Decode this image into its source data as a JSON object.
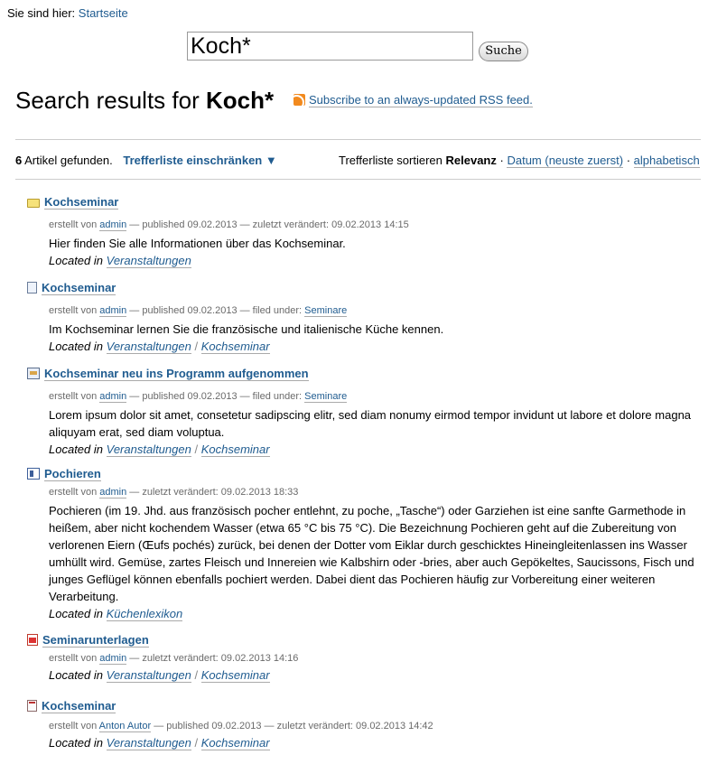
{
  "breadcrumb": {
    "prefix": "Sie sind hier:",
    "home": "Startseite"
  },
  "search": {
    "value": "Koch*",
    "button": "Suche"
  },
  "heading": {
    "prefix": "Search results for",
    "term": "Koch*"
  },
  "rss": {
    "label": "Subscribe to an always-updated RSS feed."
  },
  "bar": {
    "count": "6",
    "count_suffix": "Artikel gefunden.",
    "filter": "Trefferliste einschränken ▼",
    "sort_prefix": "Trefferliste sortieren",
    "sort_active": "Relevanz",
    "sort_date": "Datum (neuste zuerst)",
    "sort_alpha": "alphabetisch",
    "dot": "·"
  },
  "results": [
    {
      "icon": "folder-icon",
      "title": "Kochseminar",
      "by": "erstellt von",
      "author": "admin",
      "meta": "— published 09.02.2013 — zuletzt verändert: 09.02.2013 14:15",
      "desc": "Hier finden Sie alle Informationen über das Kochseminar.",
      "located": "Located in",
      "path": [
        "Veranstaltungen"
      ]
    },
    {
      "icon": "page-icon",
      "title": "Kochseminar",
      "by": "erstellt von",
      "author": "admin",
      "meta": "— published 09.02.2013 — filed under:",
      "tag": "Seminare",
      "desc": "Im Kochseminar lernen Sie die französische und italienische Küche kennen.",
      "located": "Located in",
      "path": [
        "Veranstaltungen",
        "Kochseminar"
      ]
    },
    {
      "icon": "news-icon",
      "title": "Kochseminar neu ins Programm aufgenommen",
      "by": "erstellt von",
      "author": "admin",
      "meta": "— published 09.02.2013 — filed under:",
      "tag": "Seminare",
      "desc": "Lorem ipsum dolor sit amet, consetetur sadipscing elitr, sed diam nonumy eirmod tempor invidunt ut labore et dolore magna aliquyam erat, sed diam voluptua.",
      "located": "Located in",
      "path": [
        "Veranstaltungen",
        "Kochseminar"
      ]
    },
    {
      "icon": "image-icon",
      "title": "Pochieren",
      "by": "erstellt von",
      "author": "admin",
      "meta": "— zuletzt verändert: 09.02.2013 18:33",
      "desc": "Pochieren (im 19. Jhd. aus französisch pocher entlehnt, zu poche, „Tasche“) oder Garziehen ist eine sanfte Garmethode in heißem, aber nicht kochendem Wasser (etwa 65 °C bis 75 °C). Die Bezeichnung Pochieren geht auf die Zubereitung von verlorenen Eiern (Œufs pochés) zurück, bei denen der Dotter vom Eiklar durch geschicktes Hineingleitenlassen ins Wasser umhüllt wird. Gemüse, zartes Fleisch und Innereien wie Kalbshirn oder -bries, aber auch Gepökeltes, Saucissons, Fisch und junges Geflügel können ebenfalls pochiert werden. Dabei dient das Pochieren häufig zur Vorbereitung einer weiteren Verarbeitung.",
      "located": "Located in",
      "path": [
        "Küchenlexikon"
      ]
    },
    {
      "icon": "pdf-icon",
      "title": "Seminarunterlagen",
      "by": "erstellt von",
      "author": "admin",
      "meta": "— zuletzt verändert: 09.02.2013 14:16",
      "located": "Located in",
      "path": [
        "Veranstaltungen",
        "Kochseminar"
      ]
    },
    {
      "icon": "event-icon",
      "title": "Kochseminar",
      "by": "erstellt von",
      "author": "Anton Autor",
      "meta": "— published 09.02.2013 — zuletzt verändert: 09.02.2013 14:42",
      "located": "Located in",
      "path": [
        "Veranstaltungen",
        "Kochseminar"
      ]
    }
  ]
}
